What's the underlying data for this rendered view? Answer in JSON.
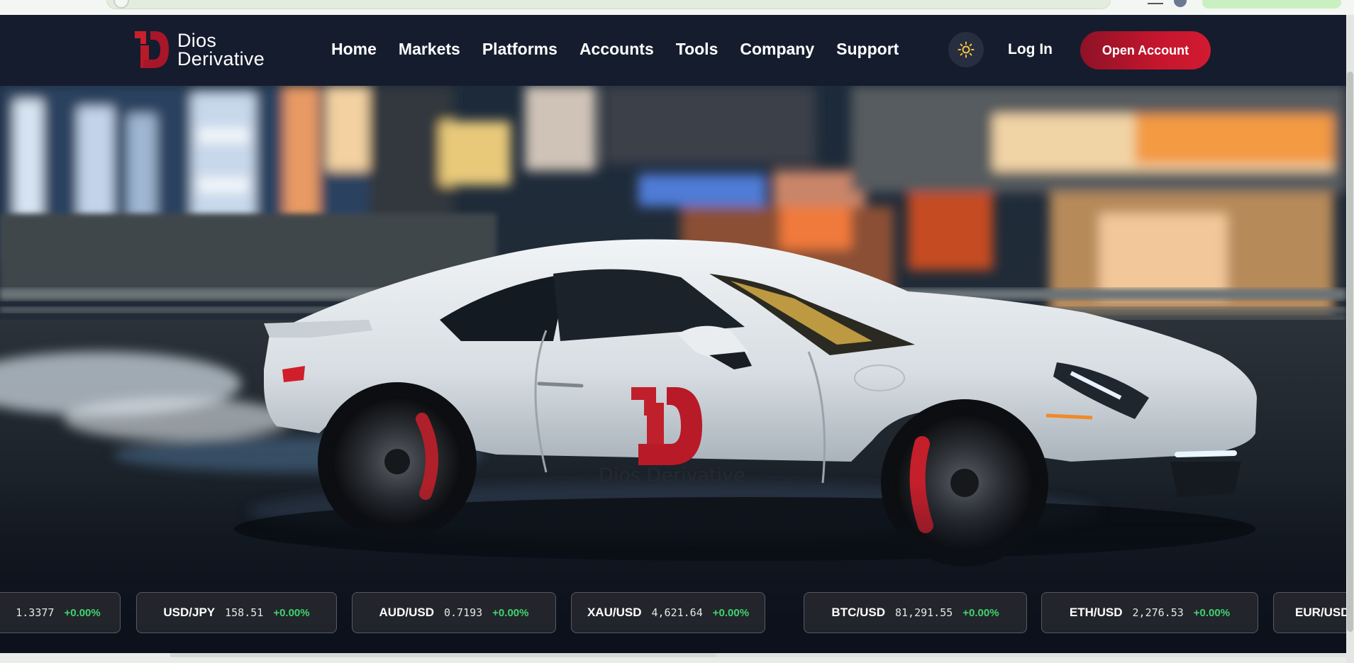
{
  "brand": {
    "name_line1": "Dios",
    "name_line2": "Derivative",
    "car_text": "Dios Derivative"
  },
  "nav": {
    "items": [
      {
        "label": "Home"
      },
      {
        "label": "Markets"
      },
      {
        "label": "Platforms"
      },
      {
        "label": "Accounts"
      },
      {
        "label": "Tools"
      },
      {
        "label": "Company"
      },
      {
        "label": "Support"
      }
    ],
    "theme_icon": "sun-icon",
    "login_label": "Log In",
    "cta_label": "Open Account"
  },
  "ticker": [
    {
      "symbol": "",
      "price": "1.3377",
      "change": "+0.00%"
    },
    {
      "symbol": "USD/JPY",
      "price": "158.51",
      "change": "+0.00%"
    },
    {
      "symbol": "AUD/USD",
      "price": "0.7193",
      "change": "+0.00%"
    },
    {
      "symbol": "XAU/USD",
      "price": "4,621.64",
      "change": "+0.00%"
    },
    {
      "symbol": "BTC/USD",
      "price": "81,291.55",
      "change": "+0.00%"
    },
    {
      "symbol": "ETH/USD",
      "price": "2,276.53",
      "change": "+0.00%"
    },
    {
      "symbol": "EUR/USD",
      "price": "",
      "change": ""
    }
  ],
  "colors": {
    "brand_red": "#c5162d",
    "nav_bg": "#151c2d",
    "positive": "#3fd46e",
    "sun": "#f5c542"
  }
}
